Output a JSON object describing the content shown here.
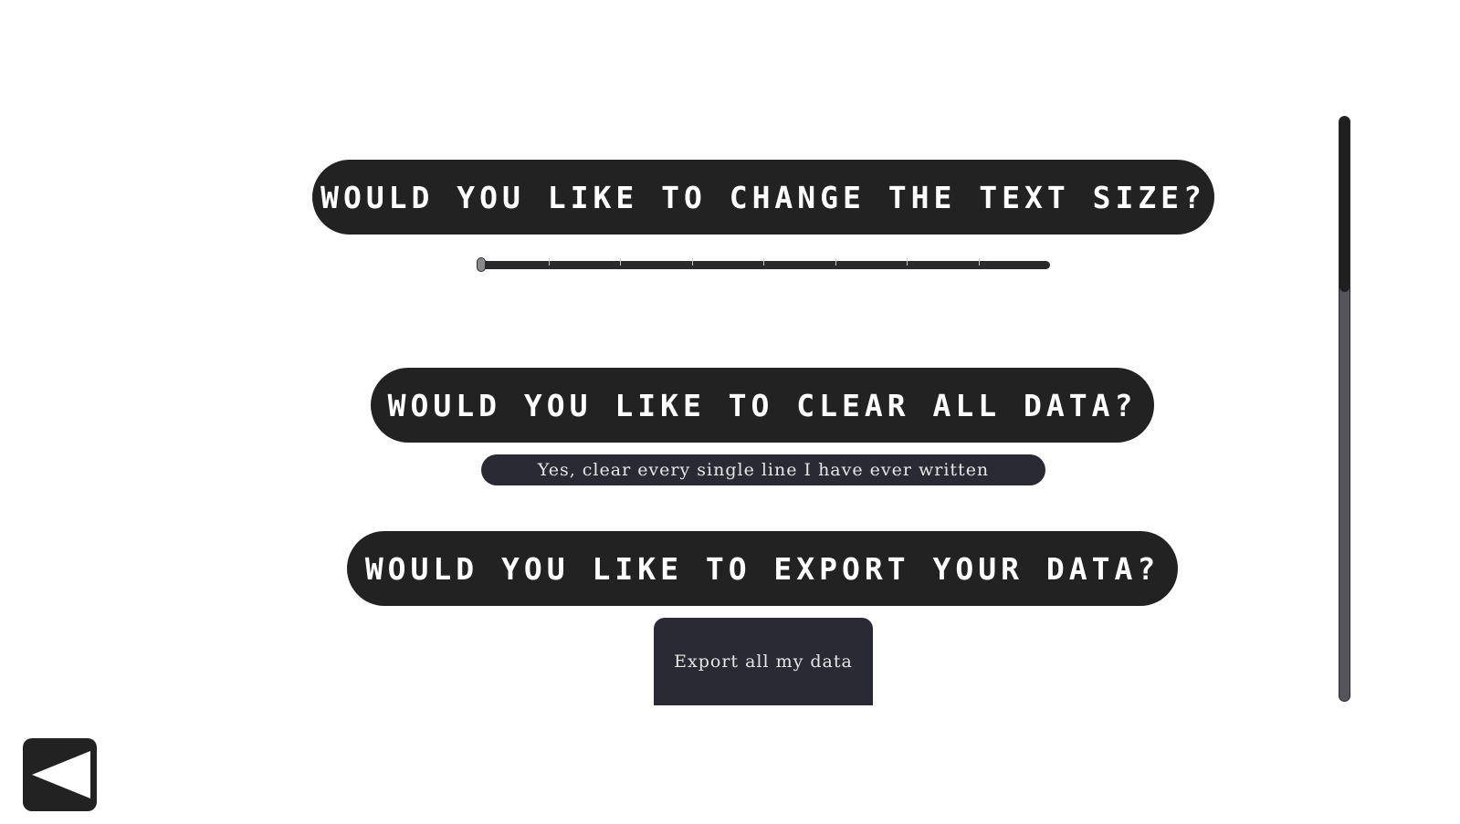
{
  "settings": {
    "text_size": {
      "question": "Would you like to change the text size?",
      "slider_value": 0,
      "slider_ticks": 8
    },
    "clear_data": {
      "question": "Would you like to clear all data?",
      "button_label": "Yes, clear every single line I have ever written"
    },
    "export_data": {
      "question": "Would you like to export your data?",
      "button_label": "Export all my data"
    }
  },
  "navigation": {
    "back_icon": "back-triangle-icon"
  },
  "scrollbar": {
    "position": 0,
    "visible_fraction": 0.3
  },
  "colors": {
    "pill_background": "#222223",
    "button_background": "#2a2a35",
    "text_light": "#ffffff"
  }
}
